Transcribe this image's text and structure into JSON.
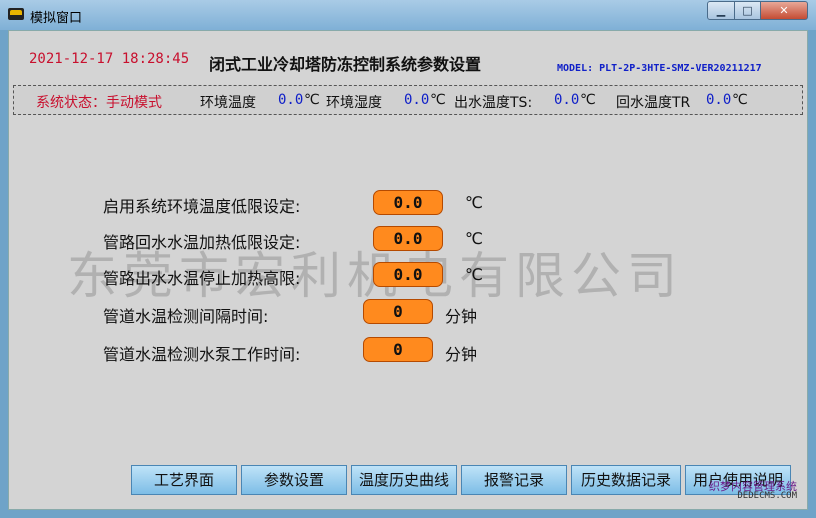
{
  "window": {
    "title": "模拟窗口",
    "min_glyph": "▁",
    "max_glyph": "□",
    "close_glyph": "✕"
  },
  "header": {
    "datetime": "2021-12-17 18:28:45",
    "title": "闭式工业冷却塔防冻控制系统参数设置",
    "model": "MODEL: PLT-2P-3HTE-SMZ-VER20211217"
  },
  "status": {
    "system_state": "系统状态：手动模式",
    "env_temp_label": "环境温度",
    "env_temp_value": "0.0",
    "env_temp_unit": "℃",
    "env_humidity_label": "环境湿度",
    "env_humidity_value": "0.0",
    "env_humidity_unit": "℃",
    "outlet_temp_label": "出水温度TS:",
    "outlet_temp_value": "0.0",
    "outlet_temp_unit": "℃",
    "return_temp_label": "回水温度TR",
    "return_temp_value": "0.0",
    "return_temp_unit": "℃"
  },
  "watermark": "东莞市宏利机电有限公司",
  "params": [
    {
      "label": "启用系统环境温度低限设定:",
      "value": "0.0",
      "unit": "℃"
    },
    {
      "label": "管路回水水温加热低限设定:",
      "value": "0.0",
      "unit": "℃"
    },
    {
      "label": "管路出水水温停止加热高限:",
      "value": "0.0",
      "unit": "℃"
    },
    {
      "label": "管道水温检测间隔时间:",
      "value": "0",
      "unit": "分钟"
    },
    {
      "label": "管道水温检测水泵工作时间:",
      "value": "0",
      "unit": "分钟"
    }
  ],
  "nav": {
    "process": "工艺界面",
    "params": "参数设置",
    "temp_history": "温度历史曲线",
    "alarms": "报警记录",
    "history_data": "历史数据记录",
    "user_manual": "用户使用说明"
  },
  "corner_watermark": {
    "line1": "织梦内容管理系统",
    "line2": "DEDECMS.COM"
  },
  "colors": {
    "field_orange": "#ff8a1e",
    "status_red": "#c8102e",
    "value_blue": "#1020c8",
    "client_gray": "#d4d4d4"
  }
}
